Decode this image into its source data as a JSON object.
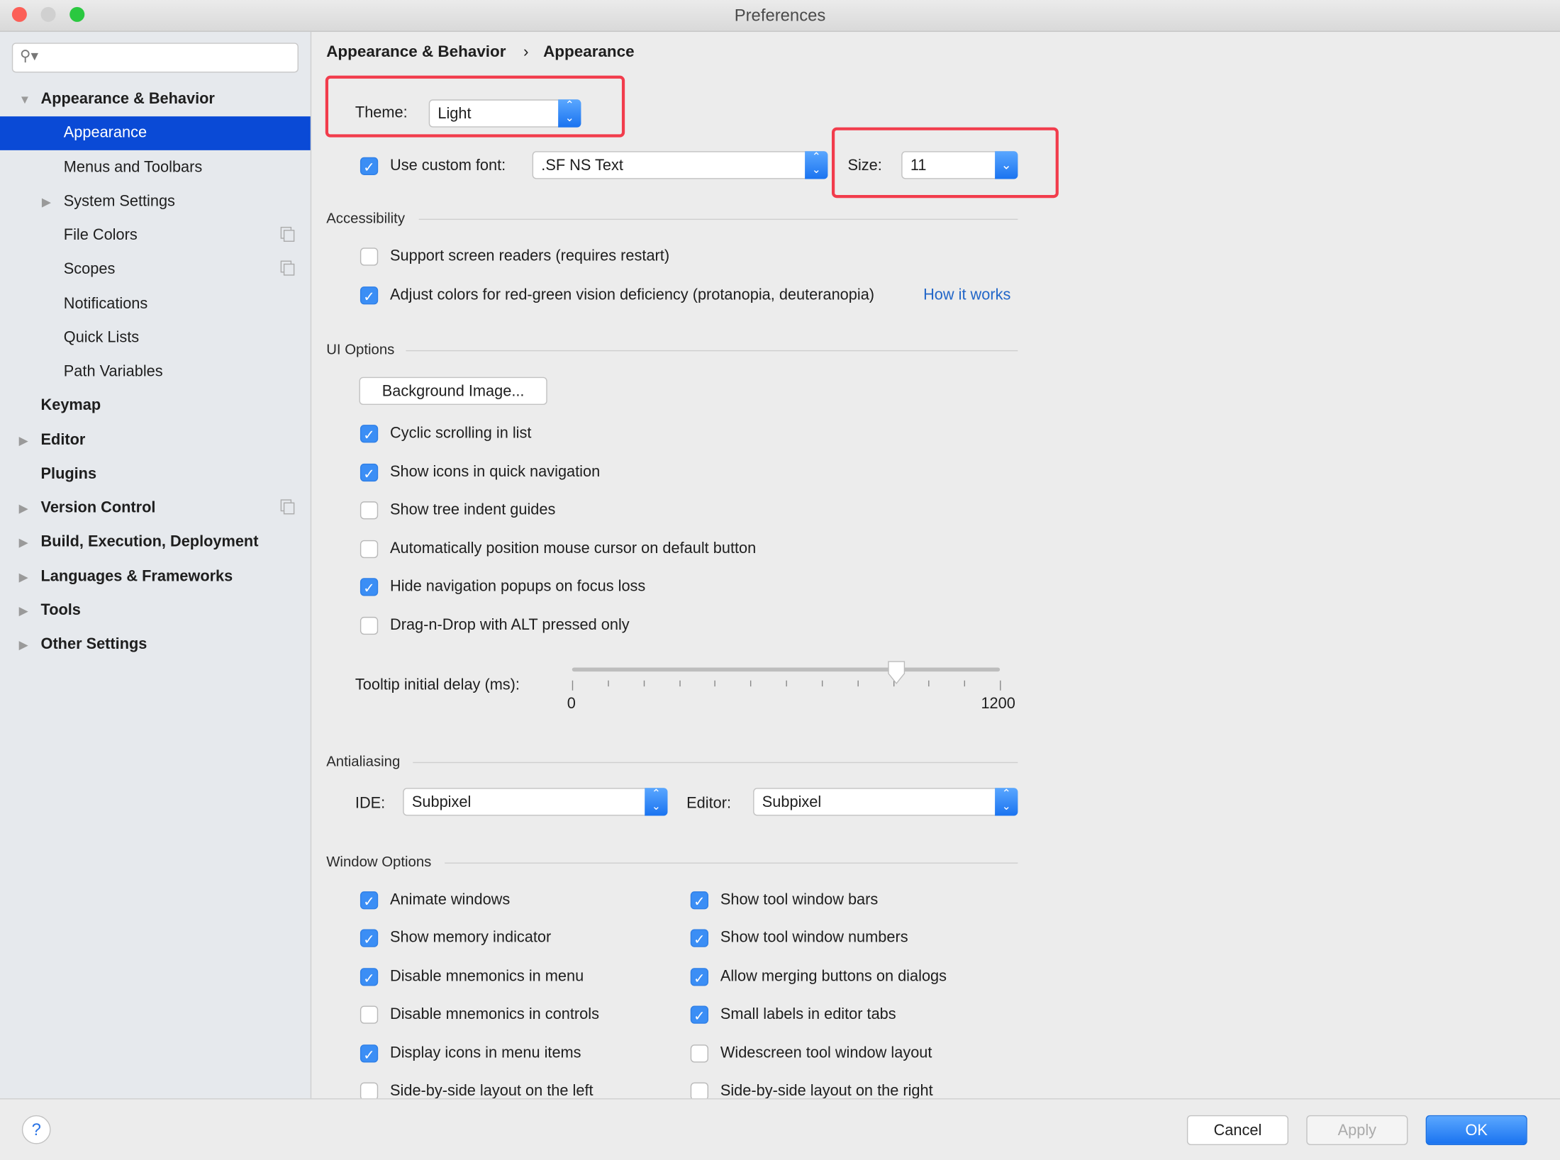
{
  "window": {
    "title": "Preferences",
    "traffic_colors": [
      "#fc5f57",
      "#d0d0d0",
      "#2ac840"
    ]
  },
  "sidebar": {
    "search_placeholder": "",
    "items": [
      {
        "label": "Appearance & Behavior",
        "level": 0,
        "bold": true,
        "arrow": "expanded"
      },
      {
        "label": "Appearance",
        "level": 1,
        "selected": true
      },
      {
        "label": "Menus and Toolbars",
        "level": 1
      },
      {
        "label": "System Settings",
        "level": 1,
        "arrow": "collapsed"
      },
      {
        "label": "File Colors",
        "level": 1,
        "copy_icon": true
      },
      {
        "label": "Scopes",
        "level": 1,
        "copy_icon": true
      },
      {
        "label": "Notifications",
        "level": 1
      },
      {
        "label": "Quick Lists",
        "level": 1
      },
      {
        "label": "Path Variables",
        "level": 1
      },
      {
        "label": "Keymap",
        "level": 0,
        "bold": true
      },
      {
        "label": "Editor",
        "level": 0,
        "bold": true,
        "arrow": "collapsed"
      },
      {
        "label": "Plugins",
        "level": 0,
        "bold": true
      },
      {
        "label": "Version Control",
        "level": 0,
        "bold": true,
        "arrow": "collapsed",
        "copy_icon": true
      },
      {
        "label": "Build, Execution, Deployment",
        "level": 0,
        "bold": true,
        "arrow": "collapsed"
      },
      {
        "label": "Languages & Frameworks",
        "level": 0,
        "bold": true,
        "arrow": "collapsed"
      },
      {
        "label": "Tools",
        "level": 0,
        "bold": true,
        "arrow": "collapsed"
      },
      {
        "label": "Other Settings",
        "level": 0,
        "bold": true,
        "arrow": "collapsed"
      }
    ]
  },
  "breadcrumb": {
    "parent": "Appearance & Behavior",
    "separator": "›",
    "current": "Appearance"
  },
  "theme": {
    "label": "Theme:",
    "value": "Light"
  },
  "font": {
    "checkbox_label": "Use custom font:",
    "checked": true,
    "value": ".SF NS Text",
    "size_label": "Size:",
    "size_value": "11"
  },
  "accessibility": {
    "header": "Accessibility",
    "items": [
      {
        "label": "Support screen readers (requires restart)",
        "checked": false
      },
      {
        "label": "Adjust colors for red-green vision deficiency (protanopia, deuteranopia)",
        "checked": true
      }
    ],
    "link": "How it works"
  },
  "ui_options": {
    "header": "UI Options",
    "bg_button": "Background Image...",
    "items": [
      {
        "label": "Cyclic scrolling in list",
        "checked": true
      },
      {
        "label": "Show icons in quick navigation",
        "checked": true
      },
      {
        "label": "Show tree indent guides",
        "checked": false
      },
      {
        "label": "Automatically position mouse cursor on default button",
        "checked": false
      },
      {
        "label": "Hide navigation popups on focus loss",
        "checked": true
      },
      {
        "label": "Drag-n-Drop with ALT pressed only",
        "checked": false
      }
    ],
    "tooltip": {
      "label": "Tooltip initial delay (ms):",
      "min": "0",
      "max": "1200",
      "value": 910
    }
  },
  "antialiasing": {
    "header": "Antialiasing",
    "ide_label": "IDE:",
    "ide_value": "Subpixel",
    "editor_label": "Editor:",
    "editor_value": "Subpixel"
  },
  "window_options": {
    "header": "Window Options",
    "left": [
      {
        "label": "Animate windows",
        "checked": true
      },
      {
        "label": "Show memory indicator",
        "checked": true
      },
      {
        "label": "Disable mnemonics in menu",
        "checked": true
      },
      {
        "label": "Disable mnemonics in controls",
        "checked": false
      },
      {
        "label": "Display icons in menu items",
        "checked": true
      },
      {
        "label": "Side-by-side layout on the left",
        "checked": false
      }
    ],
    "right": [
      {
        "label": "Show tool window bars",
        "checked": true
      },
      {
        "label": "Show tool window numbers",
        "checked": true
      },
      {
        "label": "Allow merging buttons on dialogs",
        "checked": true
      },
      {
        "label": "Small labels in editor tabs",
        "checked": true
      },
      {
        "label": "Widescreen tool window layout",
        "checked": false
      },
      {
        "label": "Side-by-side layout on the right",
        "checked": false
      }
    ]
  },
  "footer": {
    "help": "?",
    "cancel": "Cancel",
    "apply": "Apply",
    "ok": "OK"
  },
  "colors": {
    "accent": "#0a4ad6",
    "highlight_box": "#f23c4c",
    "checkbox": "#3b8ef5"
  }
}
